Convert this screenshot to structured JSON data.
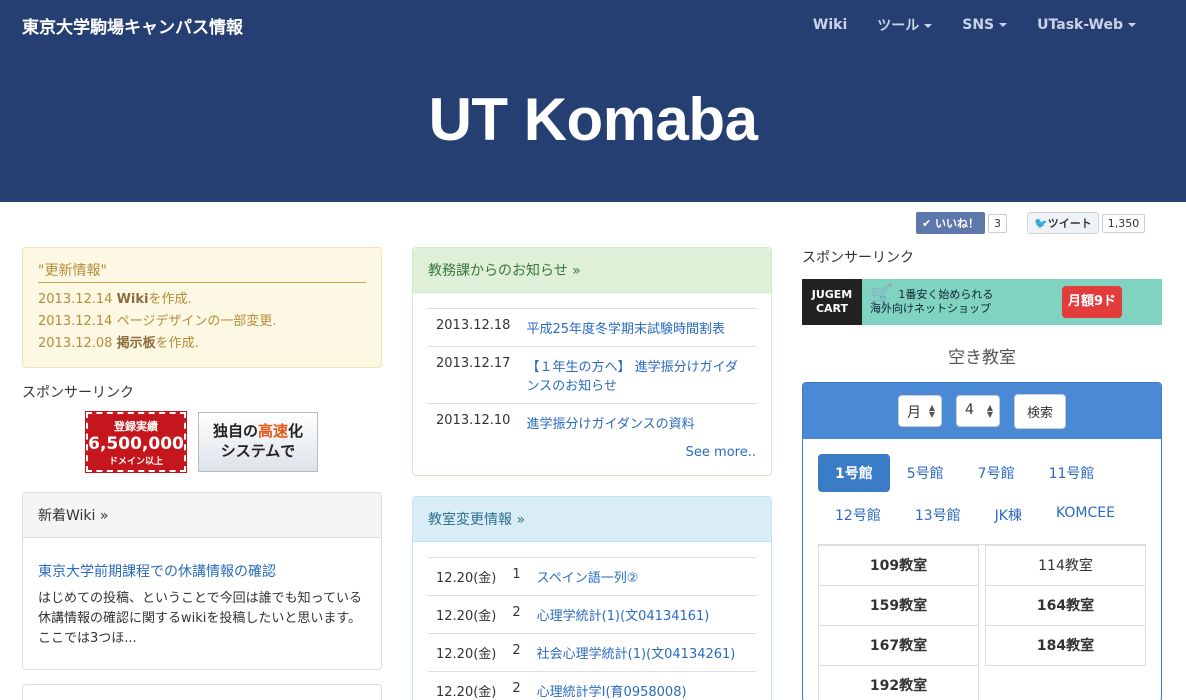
{
  "nav": {
    "brand": "東京大学駒場キャンパス情報",
    "links": [
      {
        "label": "Wiki",
        "dropdown": false
      },
      {
        "label": "ツール",
        "dropdown": true
      },
      {
        "label": "SNS",
        "dropdown": true
      },
      {
        "label": "UTask-Web",
        "dropdown": true
      }
    ]
  },
  "hero": {
    "title": "UT Komaba"
  },
  "social": {
    "like_label": "✔ いいね！",
    "like_count": "3",
    "tweet_label": "ツイート",
    "tweet_count": "1,350"
  },
  "updates": {
    "title": "\"更新情報\"",
    "rows": [
      {
        "date": "2013.12.14",
        "strong": "Wiki",
        "rest": "を作成."
      },
      {
        "date": "2013.12.14",
        "strong": "",
        "rest": "ページデザインの一部変更."
      },
      {
        "date": "2013.12.08",
        "strong": "掲示板",
        "rest": "を作成."
      }
    ]
  },
  "sponsor_label": "スポンサーリンク",
  "ad1": {
    "small": "登録実績",
    "big": "6,500,000",
    "tiny": "ドメイン以上"
  },
  "ad2": {
    "line1a": "独自の",
    "line1b": "高速",
    "line1c": "化",
    "line2": "システムで"
  },
  "wiki": {
    "header": "新着Wiki »",
    "title": "東京大学前期課程での休講情報の確認",
    "text": "はじめての投稿、ということで今回は誰でも知っている休講情報の確認に関するwikiを投稿したいと思います。 ここでは3つほ..."
  },
  "kyomu": {
    "header": "教務課からのお知らせ »",
    "rows": [
      {
        "date": "2013.12.18",
        "text": "平成25年度冬学期末試験時間割表"
      },
      {
        "date": "2013.12.17",
        "text": "【１年生の方へ】 進学振分けガイダンスのお知らせ"
      },
      {
        "date": "2013.12.10",
        "text": "進学振分けガイダンスの資料"
      }
    ],
    "more": "See more.."
  },
  "room_change": {
    "header": "教室変更情報 »",
    "rows": [
      {
        "date": "12.20(金)",
        "period": "1",
        "text": "スペイン語一列②"
      },
      {
        "date": "12.20(金)",
        "period": "2",
        "text": "心理学統計(1)(文04134161)"
      },
      {
        "date": "12.20(金)",
        "period": "2",
        "text": "社会心理学統計(1)(文04134261)"
      },
      {
        "date": "12.20(金)",
        "period": "2",
        "text": "心理統計学I(育0958008)"
      }
    ]
  },
  "jugem": {
    "logo": "JUGEM CART",
    "line1": "1番安く始められる",
    "line2": "海外向けネットショップ",
    "price": "月額9ドル"
  },
  "empty_rooms": {
    "title": "空き教室",
    "day": "月",
    "period": "4",
    "search": "検索",
    "tabs": [
      "1号館",
      "5号館",
      "7号館",
      "11号館",
      "12号館",
      "13号館",
      "JK棟",
      "KOMCEE"
    ],
    "rooms": [
      {
        "name": "109教室",
        "bold": true
      },
      {
        "name": "114教室",
        "bold": false
      },
      {
        "name": "159教室",
        "bold": true
      },
      {
        "name": "164教室",
        "bold": true
      },
      {
        "name": "167教室",
        "bold": true
      },
      {
        "name": "184教室",
        "bold": true
      },
      {
        "name": "192教室",
        "bold": true
      }
    ]
  }
}
